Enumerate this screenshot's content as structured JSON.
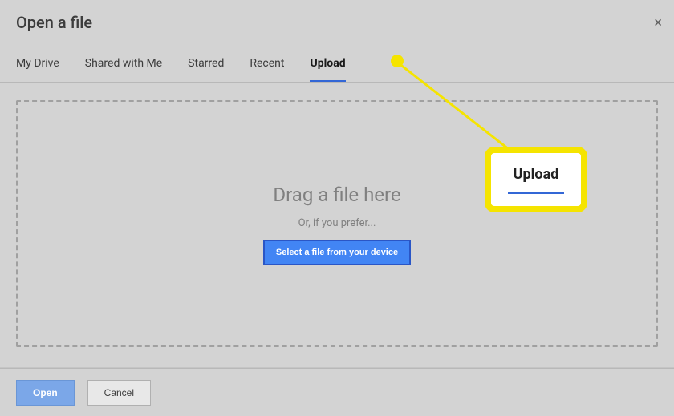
{
  "dialog": {
    "title": "Open a file",
    "close": "×"
  },
  "tabs": {
    "items": [
      {
        "label": "My Drive"
      },
      {
        "label": "Shared with Me"
      },
      {
        "label": "Starred"
      },
      {
        "label": "Recent"
      },
      {
        "label": "Upload"
      }
    ],
    "activeIndex": 4
  },
  "dropzone": {
    "drag_text": "Drag a file here",
    "or_text": "Or, if you prefer...",
    "select_button": "Select a file from your device"
  },
  "footer": {
    "open": "Open",
    "cancel": "Cancel"
  },
  "annotation": {
    "callout_text": "Upload"
  }
}
